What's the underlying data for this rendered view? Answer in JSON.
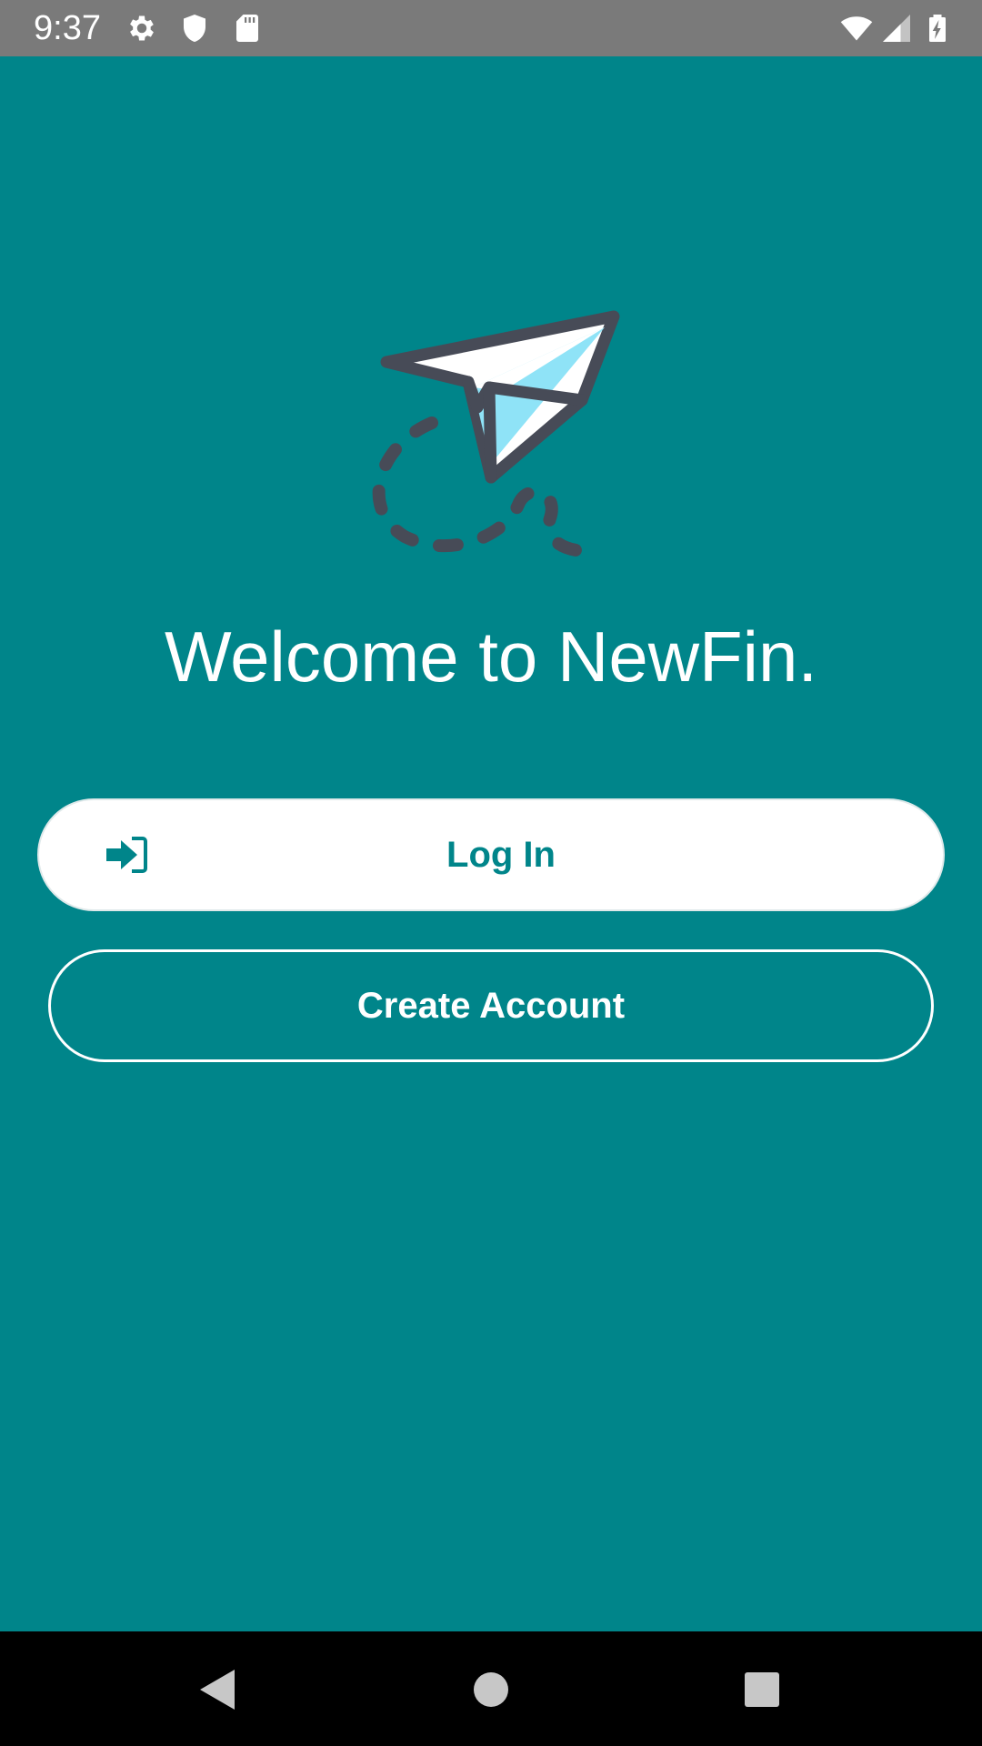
{
  "status_bar": {
    "time": "9:37",
    "left_icons": [
      "gear-icon",
      "shield-icon",
      "sd-card-icon"
    ],
    "right_icons": [
      "wifi-icon",
      "signal-icon",
      "battery-charging-icon"
    ]
  },
  "logo": {
    "icon": "paper-plane-icon"
  },
  "welcome": {
    "title": "Welcome to NewFin."
  },
  "buttons": {
    "login_label": "Log In",
    "login_icon": "login-arrow-icon",
    "create_account_label": "Create Account"
  },
  "nav_bar": {
    "icons": [
      "back-icon",
      "home-icon",
      "recents-icon"
    ]
  },
  "colors": {
    "background": "#00858a",
    "status_bar": "#7a7a7a",
    "primary_text": "#ffffff",
    "accent": "#00858a",
    "logo_stroke": "#474b57",
    "logo_fill_light": "#8fe3f7",
    "nav_bar": "#000000"
  }
}
